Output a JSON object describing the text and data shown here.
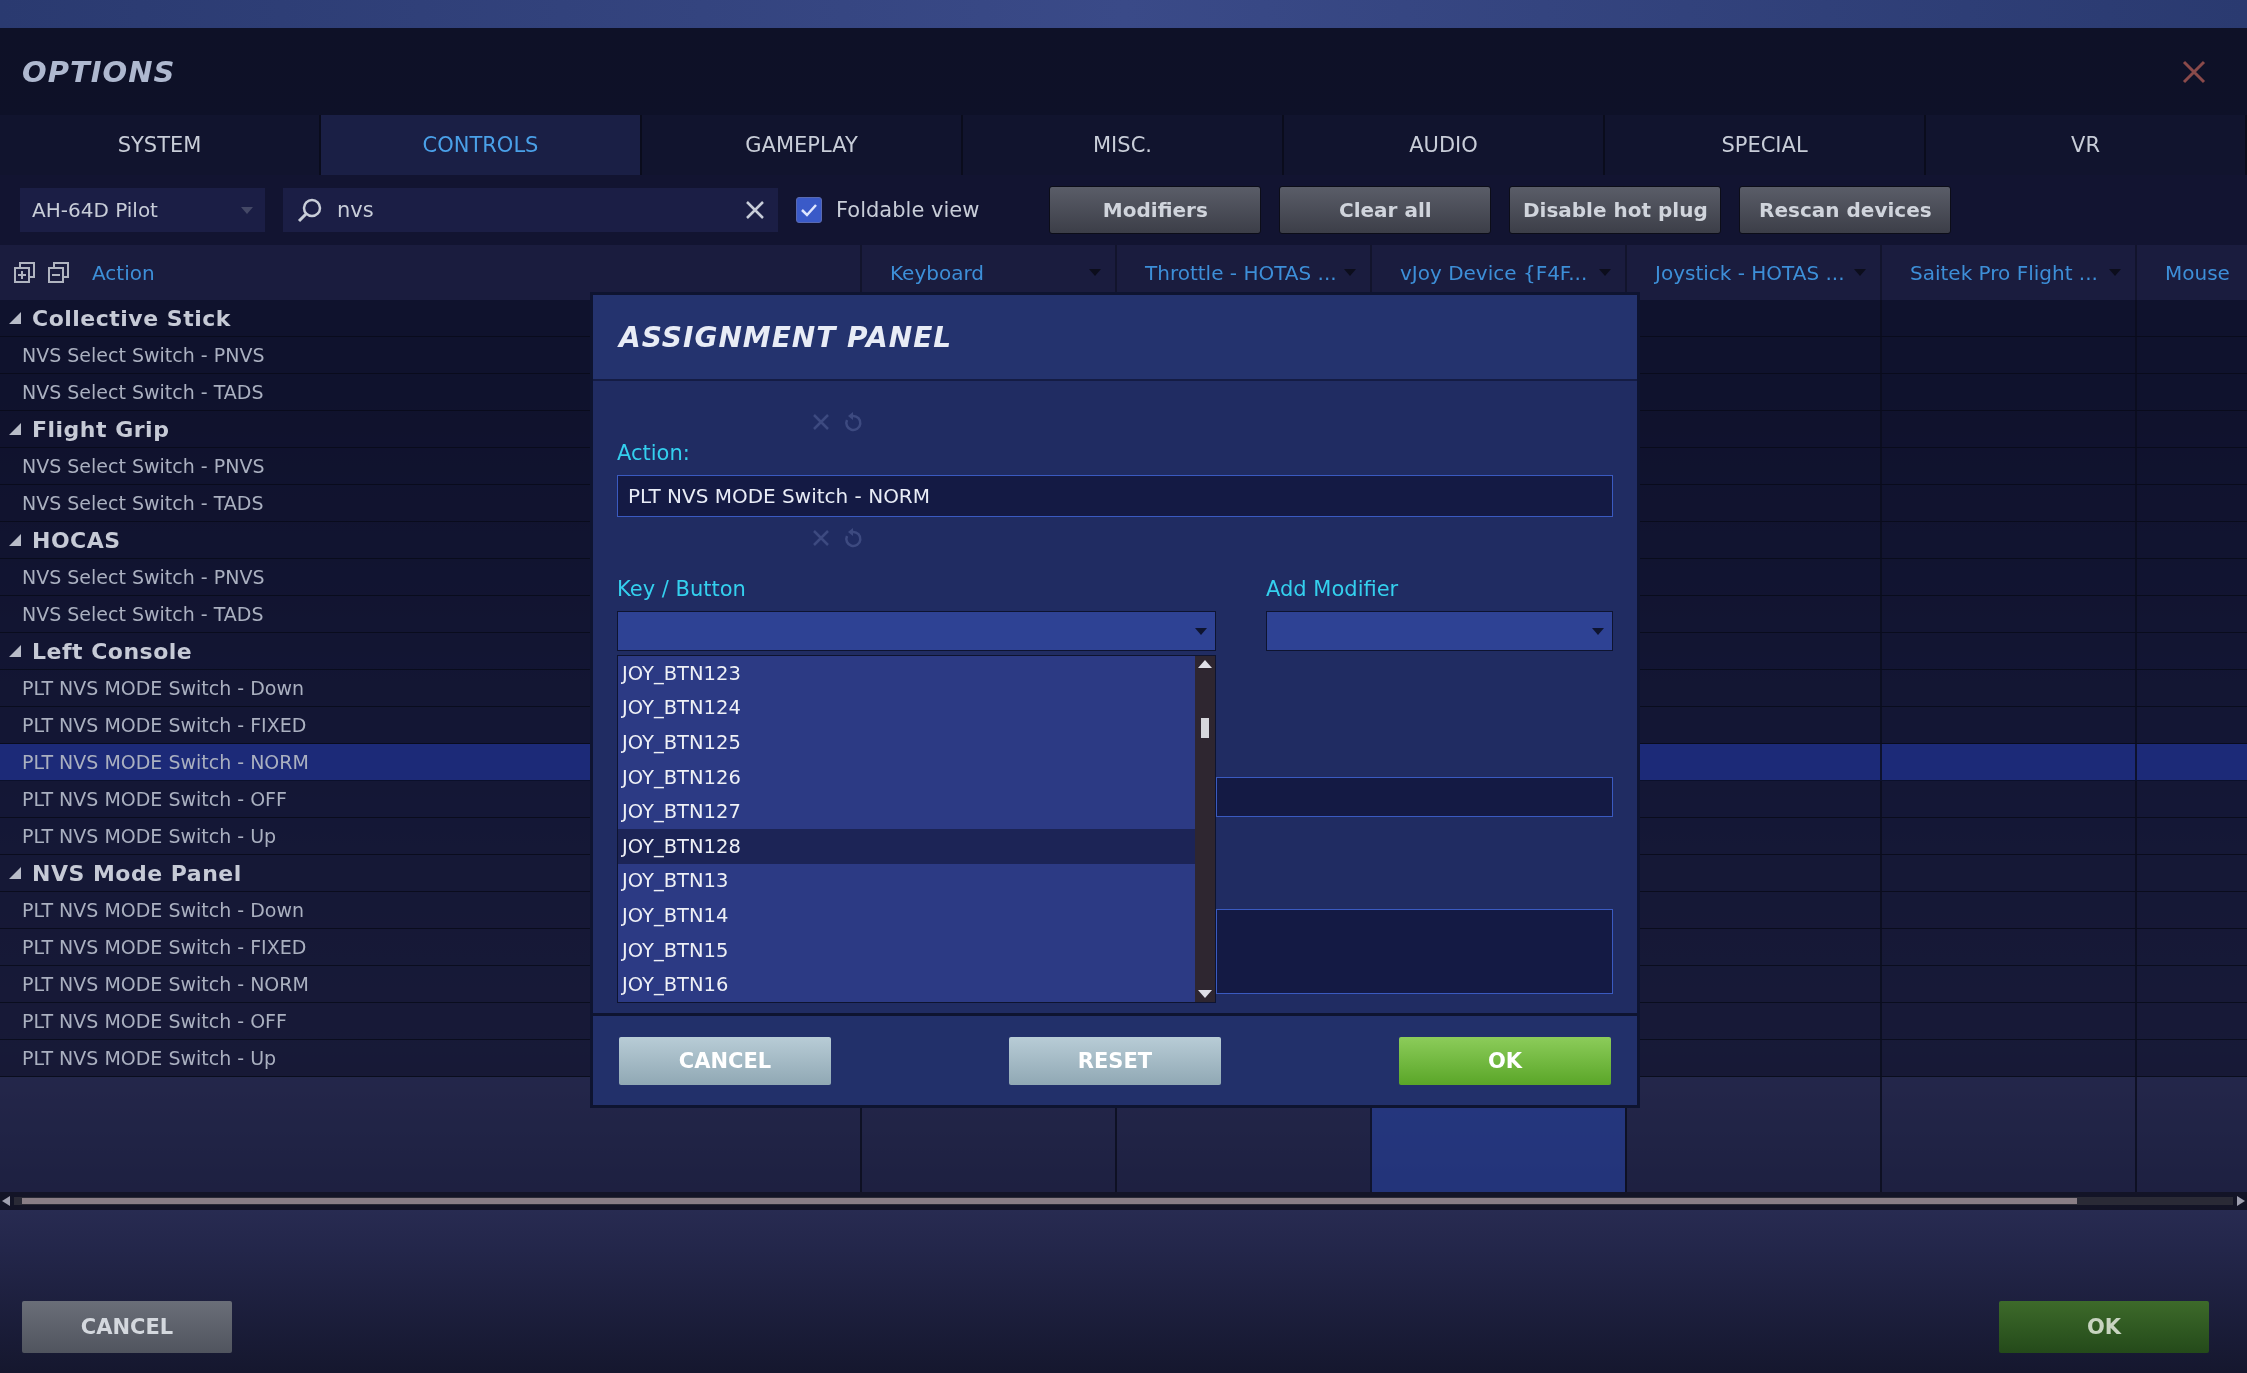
{
  "window": {
    "title": "OPTIONS"
  },
  "tabs": [
    {
      "label": "SYSTEM",
      "selected": false
    },
    {
      "label": "CONTROLS",
      "selected": true
    },
    {
      "label": "GAMEPLAY",
      "selected": false
    },
    {
      "label": "MISC.",
      "selected": false
    },
    {
      "label": "AUDIO",
      "selected": false
    },
    {
      "label": "SPECIAL",
      "selected": false
    },
    {
      "label": "VR",
      "selected": false
    }
  ],
  "toolbar": {
    "profile": "AH-64D Pilot",
    "search": {
      "value": "nvs"
    },
    "foldable_view": {
      "label": "Foldable view",
      "checked": true
    },
    "buttons": [
      "Modifiers",
      "Clear all",
      "Disable hot plug",
      "Rescan devices"
    ]
  },
  "table": {
    "action_header": "Action",
    "columns": [
      "Keyboard",
      "Throttle - HOTAS ...",
      "vJoy Device {F4F...",
      "Joystick - HOTAS ...",
      "Saitek Pro Flight ...",
      "Mouse"
    ],
    "groups": [
      {
        "name": "Collective Stick",
        "expanded": true,
        "children": [
          {
            "label": "NVS Select Switch - PNVS",
            "selected": false
          },
          {
            "label": "NVS Select Switch - TADS",
            "selected": false
          }
        ]
      },
      {
        "name": "Flight Grip",
        "expanded": true,
        "children": [
          {
            "label": "NVS Select Switch - PNVS",
            "selected": false
          },
          {
            "label": "NVS Select Switch - TADS",
            "selected": false
          }
        ]
      },
      {
        "name": "HOCAS",
        "expanded": true,
        "children": [
          {
            "label": "NVS Select Switch - PNVS",
            "selected": false
          },
          {
            "label": "NVS Select Switch - TADS",
            "selected": false
          }
        ]
      },
      {
        "name": "Left Console",
        "expanded": true,
        "children": [
          {
            "label": "PLT NVS MODE Switch - Down",
            "selected": false
          },
          {
            "label": "PLT NVS MODE Switch - FIXED",
            "selected": false
          },
          {
            "label": "PLT NVS MODE Switch - NORM",
            "selected": true
          },
          {
            "label": "PLT NVS MODE Switch - OFF",
            "selected": false
          },
          {
            "label": "PLT NVS MODE Switch - Up",
            "selected": false
          }
        ]
      },
      {
        "name": "NVS Mode Panel",
        "expanded": true,
        "children": [
          {
            "label": "PLT NVS MODE Switch - Down",
            "selected": false
          },
          {
            "label": "PLT NVS MODE Switch - FIXED",
            "selected": false
          },
          {
            "label": "PLT NVS MODE Switch - NORM",
            "selected": false
          },
          {
            "label": "PLT NVS MODE Switch - OFF",
            "selected": false
          },
          {
            "label": "PLT NVS MODE Switch - Up",
            "selected": false
          }
        ]
      }
    ]
  },
  "dialog": {
    "title": "ASSIGNMENT PANEL",
    "action_label": "Action:",
    "action_value": "PLT NVS MODE Switch - NORM",
    "key_label": "Key / Button",
    "modifier_label": "Add Modifier",
    "options": [
      {
        "label": "JOY_BTN123",
        "selected": false
      },
      {
        "label": "JOY_BTN124",
        "selected": false
      },
      {
        "label": "JOY_BTN125",
        "selected": false
      },
      {
        "label": "JOY_BTN126",
        "selected": false
      },
      {
        "label": "JOY_BTN127",
        "selected": false
      },
      {
        "label": "JOY_BTN128",
        "selected": true
      },
      {
        "label": "JOY_BTN13",
        "selected": false
      },
      {
        "label": "JOY_BTN14",
        "selected": false
      },
      {
        "label": "JOY_BTN15",
        "selected": false
      },
      {
        "label": "JOY_BTN16",
        "selected": false
      }
    ],
    "buttons": [
      {
        "label": "CANCEL",
        "kind": "secondary"
      },
      {
        "label": "RESET",
        "kind": "secondary"
      },
      {
        "label": "OK",
        "kind": "primary"
      }
    ]
  },
  "footer_buttons": [
    {
      "label": "CANCEL",
      "kind": "secondary"
    },
    {
      "label": "OK",
      "kind": "primary"
    }
  ]
}
